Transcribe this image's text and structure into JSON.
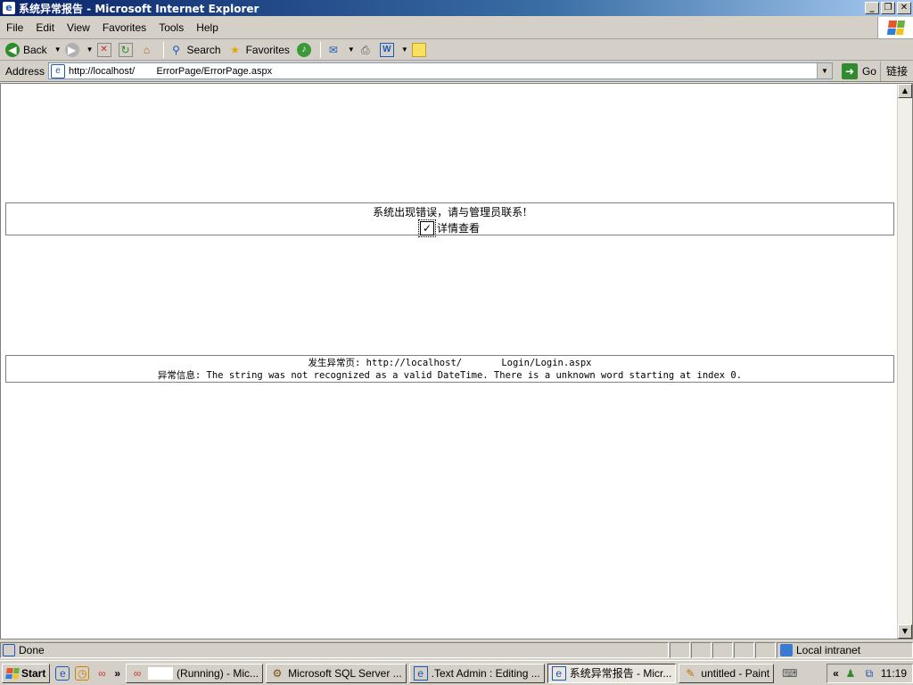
{
  "window": {
    "title": "系统异常报告 - Microsoft Internet Explorer",
    "buttons": [
      "_",
      "❐",
      "✕"
    ]
  },
  "menu": [
    {
      "label": "File"
    },
    {
      "label": "Edit"
    },
    {
      "label": "View"
    },
    {
      "label": "Favorites"
    },
    {
      "label": "Tools"
    },
    {
      "label": "Help"
    }
  ],
  "toolbar": {
    "back_label": "Back",
    "search_label": "Search",
    "favorites_label": "Favorites"
  },
  "address": {
    "label": "Address",
    "url": "http://localhost/        ErrorPage/ErrorPage.aspx",
    "go_label": "Go",
    "links_label": "链接"
  },
  "page": {
    "error_message": "系统出现错误，请与管理员联系!",
    "detail_label": "详情查看",
    "detail_checked": true,
    "error_page_line": "发生异常页: http://localhost/       Login/Login.aspx",
    "error_info_line": "异常信息: The string was not recognized as a valid DateTime. There is a unknown word starting at index 0."
  },
  "status": {
    "text": "Done",
    "zone": "Local intranet"
  },
  "taskbar": {
    "start_label": "Start",
    "tasks": [
      {
        "label": "(Running) - Mic...",
        "active": false
      },
      {
        "label": "Microsoft SQL Server ...",
        "active": false
      },
      {
        "label": ".Text Admin : Editing ...",
        "active": false
      },
      {
        "label": "系统异常报告 - Micr...",
        "active": true
      },
      {
        "label": "untitled - Paint",
        "active": false
      }
    ],
    "clock": "11:19"
  },
  "colors": {
    "titlebar": "#0a246a",
    "chrome": "#d4d0c8",
    "content_bg": "#ffffff"
  }
}
